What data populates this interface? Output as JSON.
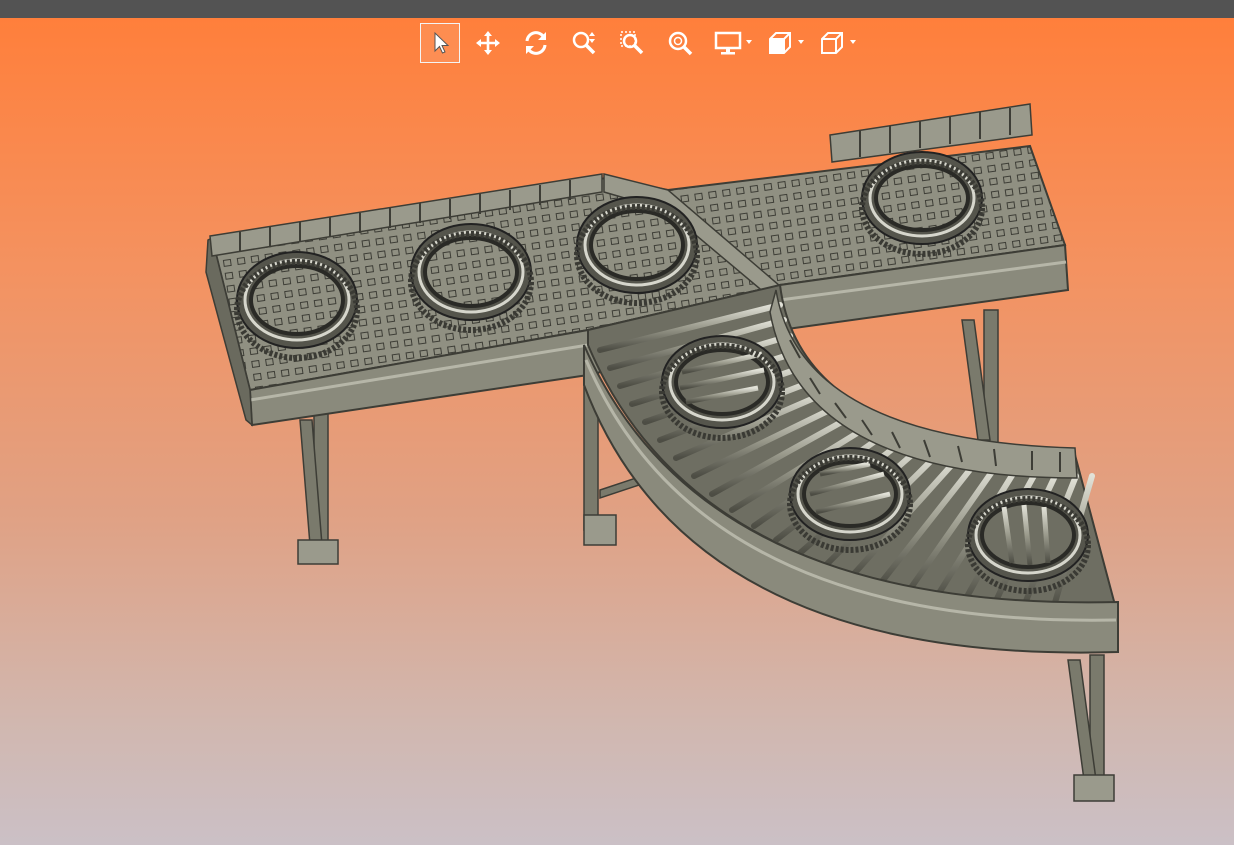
{
  "window": {
    "title": ""
  },
  "toolbar": {
    "tools": [
      {
        "id": "select",
        "icon": "pointer-arrow-icon",
        "active": true
      },
      {
        "id": "pan",
        "icon": "move-arrows-icon",
        "active": false
      },
      {
        "id": "rotate",
        "icon": "rotate-icon",
        "active": false
      },
      {
        "id": "zoom",
        "icon": "zoom-updown-icon",
        "active": false
      },
      {
        "id": "zoom-window",
        "icon": "zoom-window-icon",
        "active": false
      },
      {
        "id": "zoom-fit",
        "icon": "zoom-fit-icon",
        "active": false
      },
      {
        "id": "display",
        "icon": "monitor-icon",
        "has_dropdown": true
      },
      {
        "id": "section",
        "icon": "section-view-icon",
        "has_dropdown": true
      },
      {
        "id": "view-orientation",
        "icon": "cube-view-icon",
        "has_dropdown": true
      }
    ]
  },
  "scene": {
    "description_hidden": true,
    "colors": {
      "frame": "#8a8a7c",
      "frame_dark": "#3d3d36",
      "frame_light": "#b6b6a8",
      "tire": "#55554c",
      "tire_light": "#d6d6cc",
      "background_top": "#ff7f3b",
      "background_bottom": "#cbc0c6"
    }
  }
}
